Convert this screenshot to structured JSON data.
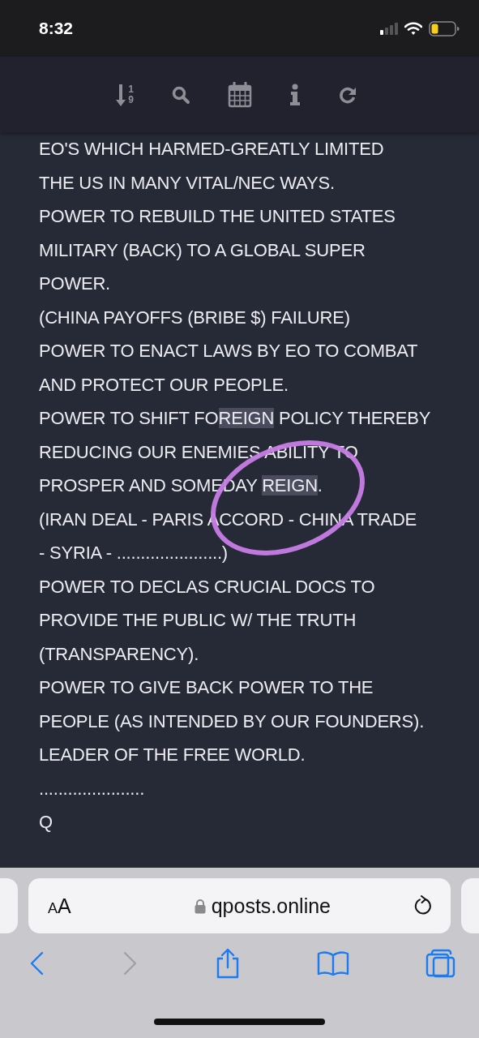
{
  "status_bar": {
    "time": "8:32"
  },
  "toolbar": {
    "items": [
      {
        "kind": "sort",
        "digits": [
          "1",
          "9"
        ]
      },
      {
        "kind": "search"
      },
      {
        "kind": "calendar"
      },
      {
        "kind": "info"
      },
      {
        "kind": "refresh"
      }
    ]
  },
  "post": {
    "lines": [
      {
        "parts": [
          {
            "text": "EO'S WHICH HARMED-GREATLY LIMITED",
            "highlighted": false
          }
        ]
      },
      {
        "parts": [
          {
            "text": "THE US IN MANY VITAL/NEC WAYS.",
            "highlighted": false
          }
        ]
      },
      {
        "parts": [
          {
            "text": "POWER TO REBUILD THE UNITED STATES",
            "highlighted": false
          }
        ]
      },
      {
        "parts": [
          {
            "text": "MILITARY (BACK) TO A GLOBAL SUPER",
            "highlighted": false
          }
        ]
      },
      {
        "parts": [
          {
            "text": "POWER.",
            "highlighted": false
          }
        ]
      },
      {
        "parts": [
          {
            "text": "(CHINA PAYOFFS (BRIBE $) FAILURE)",
            "highlighted": false
          }
        ]
      },
      {
        "parts": [
          {
            "text": "POWER TO ENACT LAWS BY EO TO COMBAT",
            "highlighted": false
          }
        ]
      },
      {
        "parts": [
          {
            "text": "AND PROTECT OUR PEOPLE.",
            "highlighted": false
          }
        ]
      },
      {
        "parts": [
          {
            "text": "POWER TO SHIFT FO",
            "highlighted": false
          },
          {
            "text": "REIGN",
            "highlighted": true
          },
          {
            "text": " POLICY THEREBY",
            "highlighted": false
          }
        ]
      },
      {
        "parts": [
          {
            "text": "REDUCING OUR ENEMIES ABILITY TO",
            "highlighted": false
          }
        ]
      },
      {
        "parts": [
          {
            "text": "PROSPER AND SOMEDAY ",
            "highlighted": false
          },
          {
            "text": "REIGN",
            "highlighted": true
          },
          {
            "text": ".",
            "highlighted": false
          }
        ]
      },
      {
        "parts": [
          {
            "text": "(IRAN DEAL - PARIS ACCORD - CHINA TRADE",
            "highlighted": false
          }
        ]
      },
      {
        "parts": [
          {
            "text": "- SYRIA - ......................)",
            "highlighted": false
          }
        ]
      },
      {
        "parts": [
          {
            "text": "POWER TO DECLAS CRUCIAL DOCS TO",
            "highlighted": false
          }
        ]
      },
      {
        "parts": [
          {
            "text": "PROVIDE THE PUBLIC W/ THE TRUTH",
            "highlighted": false
          }
        ]
      },
      {
        "parts": [
          {
            "text": "(TRANSPARENCY).",
            "highlighted": false
          }
        ]
      },
      {
        "parts": [
          {
            "text": "POWER TO GIVE BACK POWER TO THE",
            "highlighted": false
          }
        ]
      },
      {
        "parts": [
          {
            "text": "PEOPLE (AS INTENDED BY OUR FOUNDERS).",
            "highlighted": false
          }
        ]
      },
      {
        "parts": [
          {
            "text": "LEADER OF THE FREE WORLD.",
            "highlighted": false
          }
        ]
      },
      {
        "parts": [
          {
            "text": "......................",
            "highlighted": false
          }
        ]
      },
      {
        "parts": [
          {
            "text": "Q",
            "highlighted": false
          }
        ]
      }
    ],
    "markup": [
      {
        "kind": "circle"
      }
    ]
  },
  "browser": {
    "text_size_label": "AA",
    "url": "qposts.online",
    "nav": [
      {
        "kind": "back",
        "disabled": false
      },
      {
        "kind": "forward",
        "disabled": true
      },
      {
        "kind": "share",
        "disabled": false
      },
      {
        "kind": "bookmarks",
        "disabled": false
      },
      {
        "kind": "tabs",
        "disabled": false
      }
    ]
  }
}
